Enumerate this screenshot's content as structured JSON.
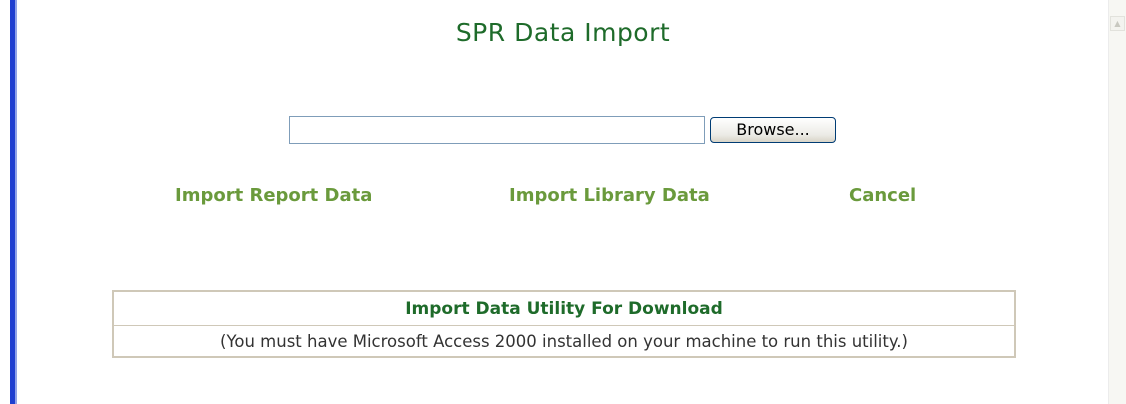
{
  "page": {
    "title": "SPR Data Import"
  },
  "file_upload": {
    "value": "",
    "browse_label": "Browse..."
  },
  "actions": {
    "import_report": "Import Report Data",
    "import_library": "Import Library Data",
    "cancel": "Cancel"
  },
  "utility": {
    "title": "Import Data Utility For Download",
    "note": "(You must have Microsoft Access 2000 installed on your machine to run this utility.)"
  },
  "colors": {
    "accent_green": "#1e6b2a",
    "link_green": "#6a9a3c",
    "left_bar_blue": "#1f3fd0"
  },
  "icons": {
    "scroll_up": "scroll-up-arrow-icon"
  }
}
